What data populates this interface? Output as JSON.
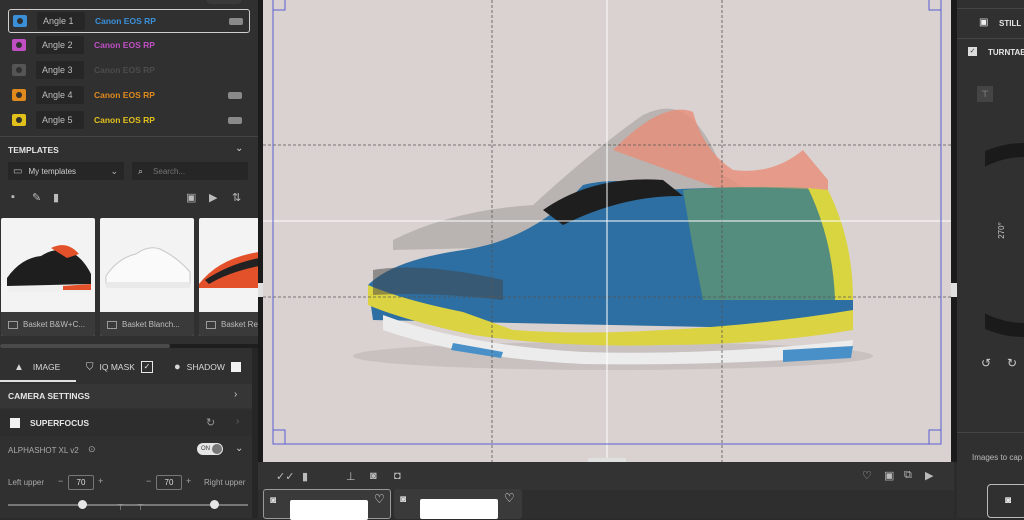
{
  "angles": [
    {
      "label": "Angle 1",
      "camera": "Canon EOS RP",
      "color": "#3a8fd9",
      "cam_text_color": "#3a8fd9",
      "selected": true,
      "toggle": true
    },
    {
      "label": "Angle 2",
      "camera": "Canon EOS RP",
      "color": "#c04fc4",
      "cam_text_color": "#c04fc4",
      "selected": false,
      "toggle": false
    },
    {
      "label": "Angle 3",
      "camera": "Canon EOS RP",
      "color": "#555555",
      "cam_text_color": "#4c4c4c",
      "selected": false,
      "toggle": false
    },
    {
      "label": "Angle 4",
      "camera": "Canon EOS RP",
      "color": "#e08a1e",
      "cam_text_color": "#e08a1e",
      "selected": false,
      "toggle": true
    },
    {
      "label": "Angle 5",
      "camera": "Canon EOS RP",
      "color": "#e3c11c",
      "cam_text_color": "#e3c11c",
      "selected": false,
      "toggle": true
    }
  ],
  "templates": {
    "title": "TEMPLATES",
    "folder": "My templates",
    "search_placeholder": "Search...",
    "items": [
      {
        "name": "Basket B&W+C..."
      },
      {
        "name": "Basket Blanch..."
      },
      {
        "name": "Basket Re"
      }
    ]
  },
  "tabs": {
    "image": "IMAGE",
    "iq_mask": "IQ MASK",
    "shadow": "SHADOW"
  },
  "settings": {
    "camera_settings": "CAMERA SETTINGS",
    "superfocus": "SUPERFOCUS",
    "alphashot": "ALPHASHOT XL v2",
    "toggle": "ON",
    "left_upper_label": "Left upper",
    "left_upper_value": "70",
    "right_upper_label": "Right upper",
    "right_upper_value": "70"
  },
  "right_panel": {
    "still": "STILL",
    "turntable": "TURNTAB",
    "angle_label": "270°",
    "images_to_cap": "Images to cap"
  },
  "colors": {
    "accent_blue": "#5b5fd6",
    "panel": "#303030"
  }
}
